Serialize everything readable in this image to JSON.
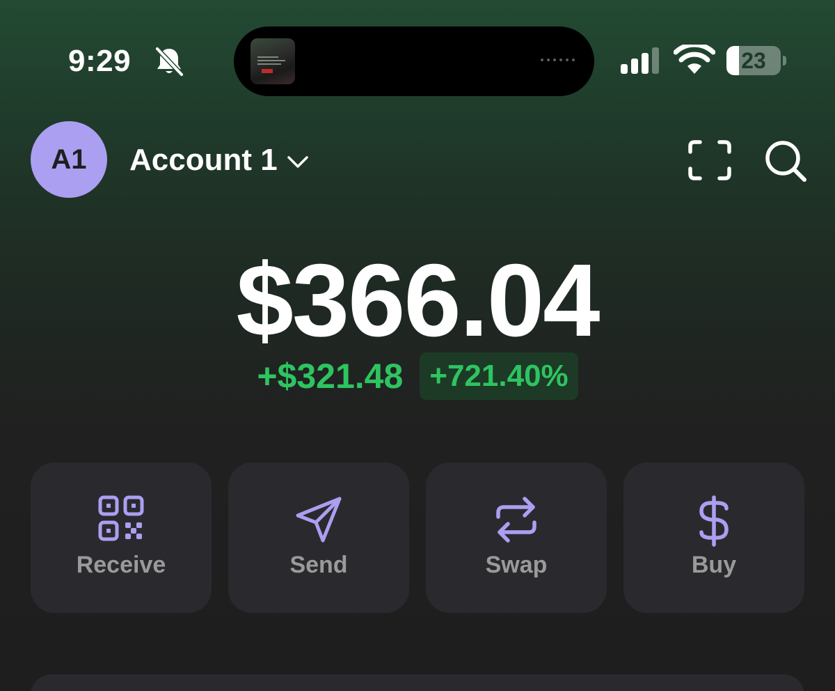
{
  "status_bar": {
    "time": "9:29",
    "battery_level": "23",
    "battery_fraction": 0.23,
    "icons": [
      "bell-slash-icon",
      "signal-icon",
      "wifi-icon",
      "battery-icon"
    ]
  },
  "header": {
    "avatar_initials": "A1",
    "account_name": "Account 1",
    "icons": [
      "chevron-down-icon",
      "scan-icon",
      "search-icon"
    ]
  },
  "balance": {
    "total": "$366.04",
    "change_amount": "+$321.48",
    "change_percent": "+721.40%"
  },
  "actions": [
    {
      "label": "Receive",
      "icon": "qr-code-icon"
    },
    {
      "label": "Send",
      "icon": "send-icon"
    },
    {
      "label": "Swap",
      "icon": "swap-icon"
    },
    {
      "label": "Buy",
      "icon": "dollar-icon"
    }
  ],
  "colors": {
    "accent": "#ab9ff2",
    "positive": "#2ec461",
    "card": "#2a2a2e",
    "label_gray": "#9a9a9a"
  }
}
